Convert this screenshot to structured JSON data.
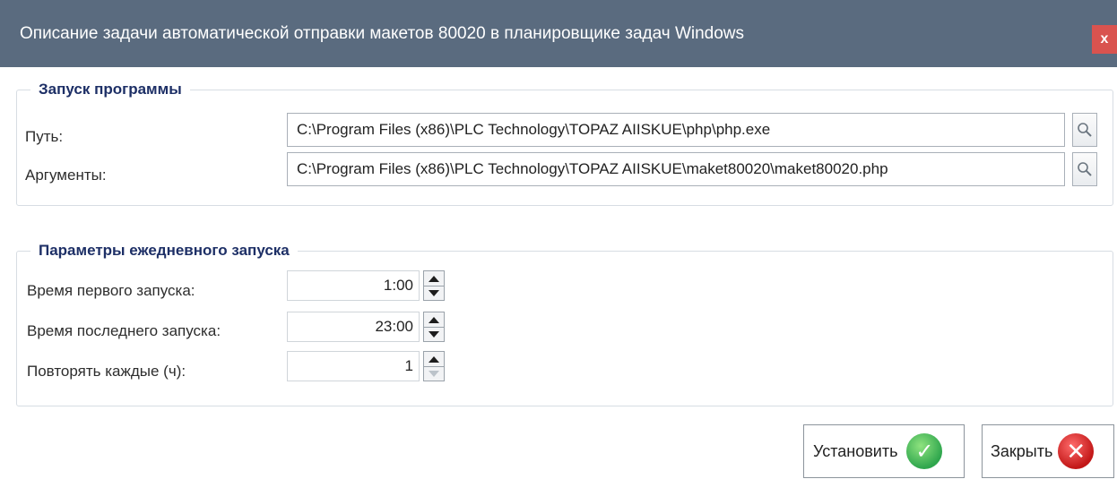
{
  "window": {
    "title": "Описание задачи автоматической отправки макетов 80020 в планировщике задач Windows",
    "close_label": "x"
  },
  "program_group": {
    "title": "Запуск программы",
    "path_label": "Путь:",
    "path_value": "C:\\Program Files (x86)\\PLC Technology\\TOPAZ AIISKUE\\php\\php.exe",
    "args_label": "Аргументы:",
    "args_value": "C:\\Program Files (x86)\\PLC Technology\\TOPAZ AIISKUE\\maket80020\\maket80020.php"
  },
  "schedule_group": {
    "title": "Параметры ежедневного запуска",
    "first_label": "Время первого запуска:",
    "first_value": "1:00",
    "last_label": "Время последнего запуска:",
    "last_value": "23:00",
    "repeat_label": "Повторять каждые (ч):",
    "repeat_value": "1"
  },
  "buttons": {
    "install_label": "Установить",
    "close_label": "Закрыть"
  },
  "colors": {
    "titlebar": "#5a6b7f",
    "group_title": "#1d2f66",
    "close_x": "#d9534f"
  }
}
